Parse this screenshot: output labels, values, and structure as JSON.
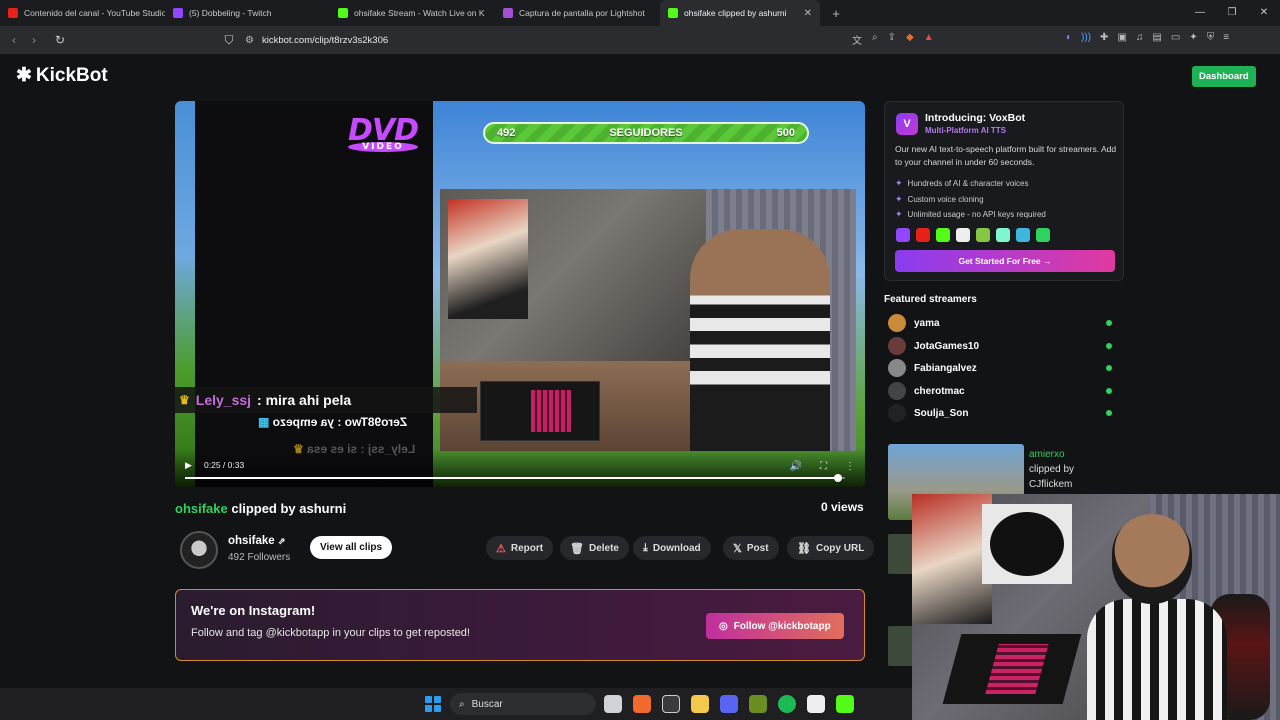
{
  "browser": {
    "tabs": [
      {
        "label": "Contenido del canal - YouTube Studio",
        "color": "#e62117"
      },
      {
        "label": "(5) Dobbeling - Twitch",
        "color": "#9146ff"
      },
      {
        "label": "ohsifake Stream - Watch Live on K",
        "color": "#53fc18"
      },
      {
        "label": "Captura de pantalla por Lightshot",
        "color": "#a24fd6"
      },
      {
        "label": "ohsifake clipped by ashurni",
        "color": "#53fc18"
      }
    ],
    "url": "kickbot.com/clip/t8rzv3s2k306"
  },
  "site": {
    "logo": "KickBot",
    "dashboard_label": "Dashboard"
  },
  "video": {
    "follow_current": "492",
    "follow_label": "SEGUIDORES",
    "follow_goal": "500",
    "follow_progress": 0.984,
    "dvd_text": "DVD",
    "dvd_sub": "VIDEO",
    "chat_line_1": "Zero98Two : ya empezo",
    "chat_line_2": "Lely_ssj : si es esa",
    "time": "0:25 / 0:33",
    "progress": 0.99,
    "overlay_chat": {
      "user": "Lely_ssj",
      "message": ": mira ahi pela"
    }
  },
  "clip": {
    "streamer": "ohsifake",
    "clipped_by_text": " clipped by ashurni",
    "views": "0 views",
    "channel_name": "ohsifake",
    "followers": "492 Followers",
    "view_all": "View all clips",
    "actions": [
      {
        "label": "Report",
        "icon": "⚠"
      },
      {
        "label": "Delete",
        "icon": "🗑"
      },
      {
        "label": "Download",
        "icon": "⤓"
      },
      {
        "label": "Post",
        "icon": "𝕏"
      },
      {
        "label": "Copy URL",
        "icon": "⛓"
      }
    ]
  },
  "instagram": {
    "title": "We're on Instagram!",
    "text": "Follow and tag @kickbotapp in your clips to get reposted!",
    "button": "Follow @kickbotapp"
  },
  "voxbot": {
    "title": "Introducing: VoxBot",
    "subtitle": "Multi-Platform AI TTS",
    "description": "Our new AI text-to-speech platform built for streamers. Add to your channel in under 60 seconds.",
    "features": [
      "Hundreds of AI & character voices",
      "Custom voice cloning",
      "Unlimited usage - no API keys required"
    ],
    "cta": "Get Started For Free →"
  },
  "featured": {
    "title": "Featured streamers",
    "streamers": [
      {
        "name": "yama",
        "color": "#c98a3a"
      },
      {
        "name": "JotaGames10",
        "color": "#6b3a3a"
      },
      {
        "name": "Fabiangalvez",
        "color": "#888888"
      },
      {
        "name": "cherotmac",
        "color": "#444444"
      },
      {
        "name": "Soulja_Son",
        "color": "#222222"
      }
    ]
  },
  "related_clip": {
    "user": "amierxo",
    "line2": "clipped by",
    "line3": "CJflickem"
  },
  "taskbar": {
    "search": "Buscar"
  }
}
